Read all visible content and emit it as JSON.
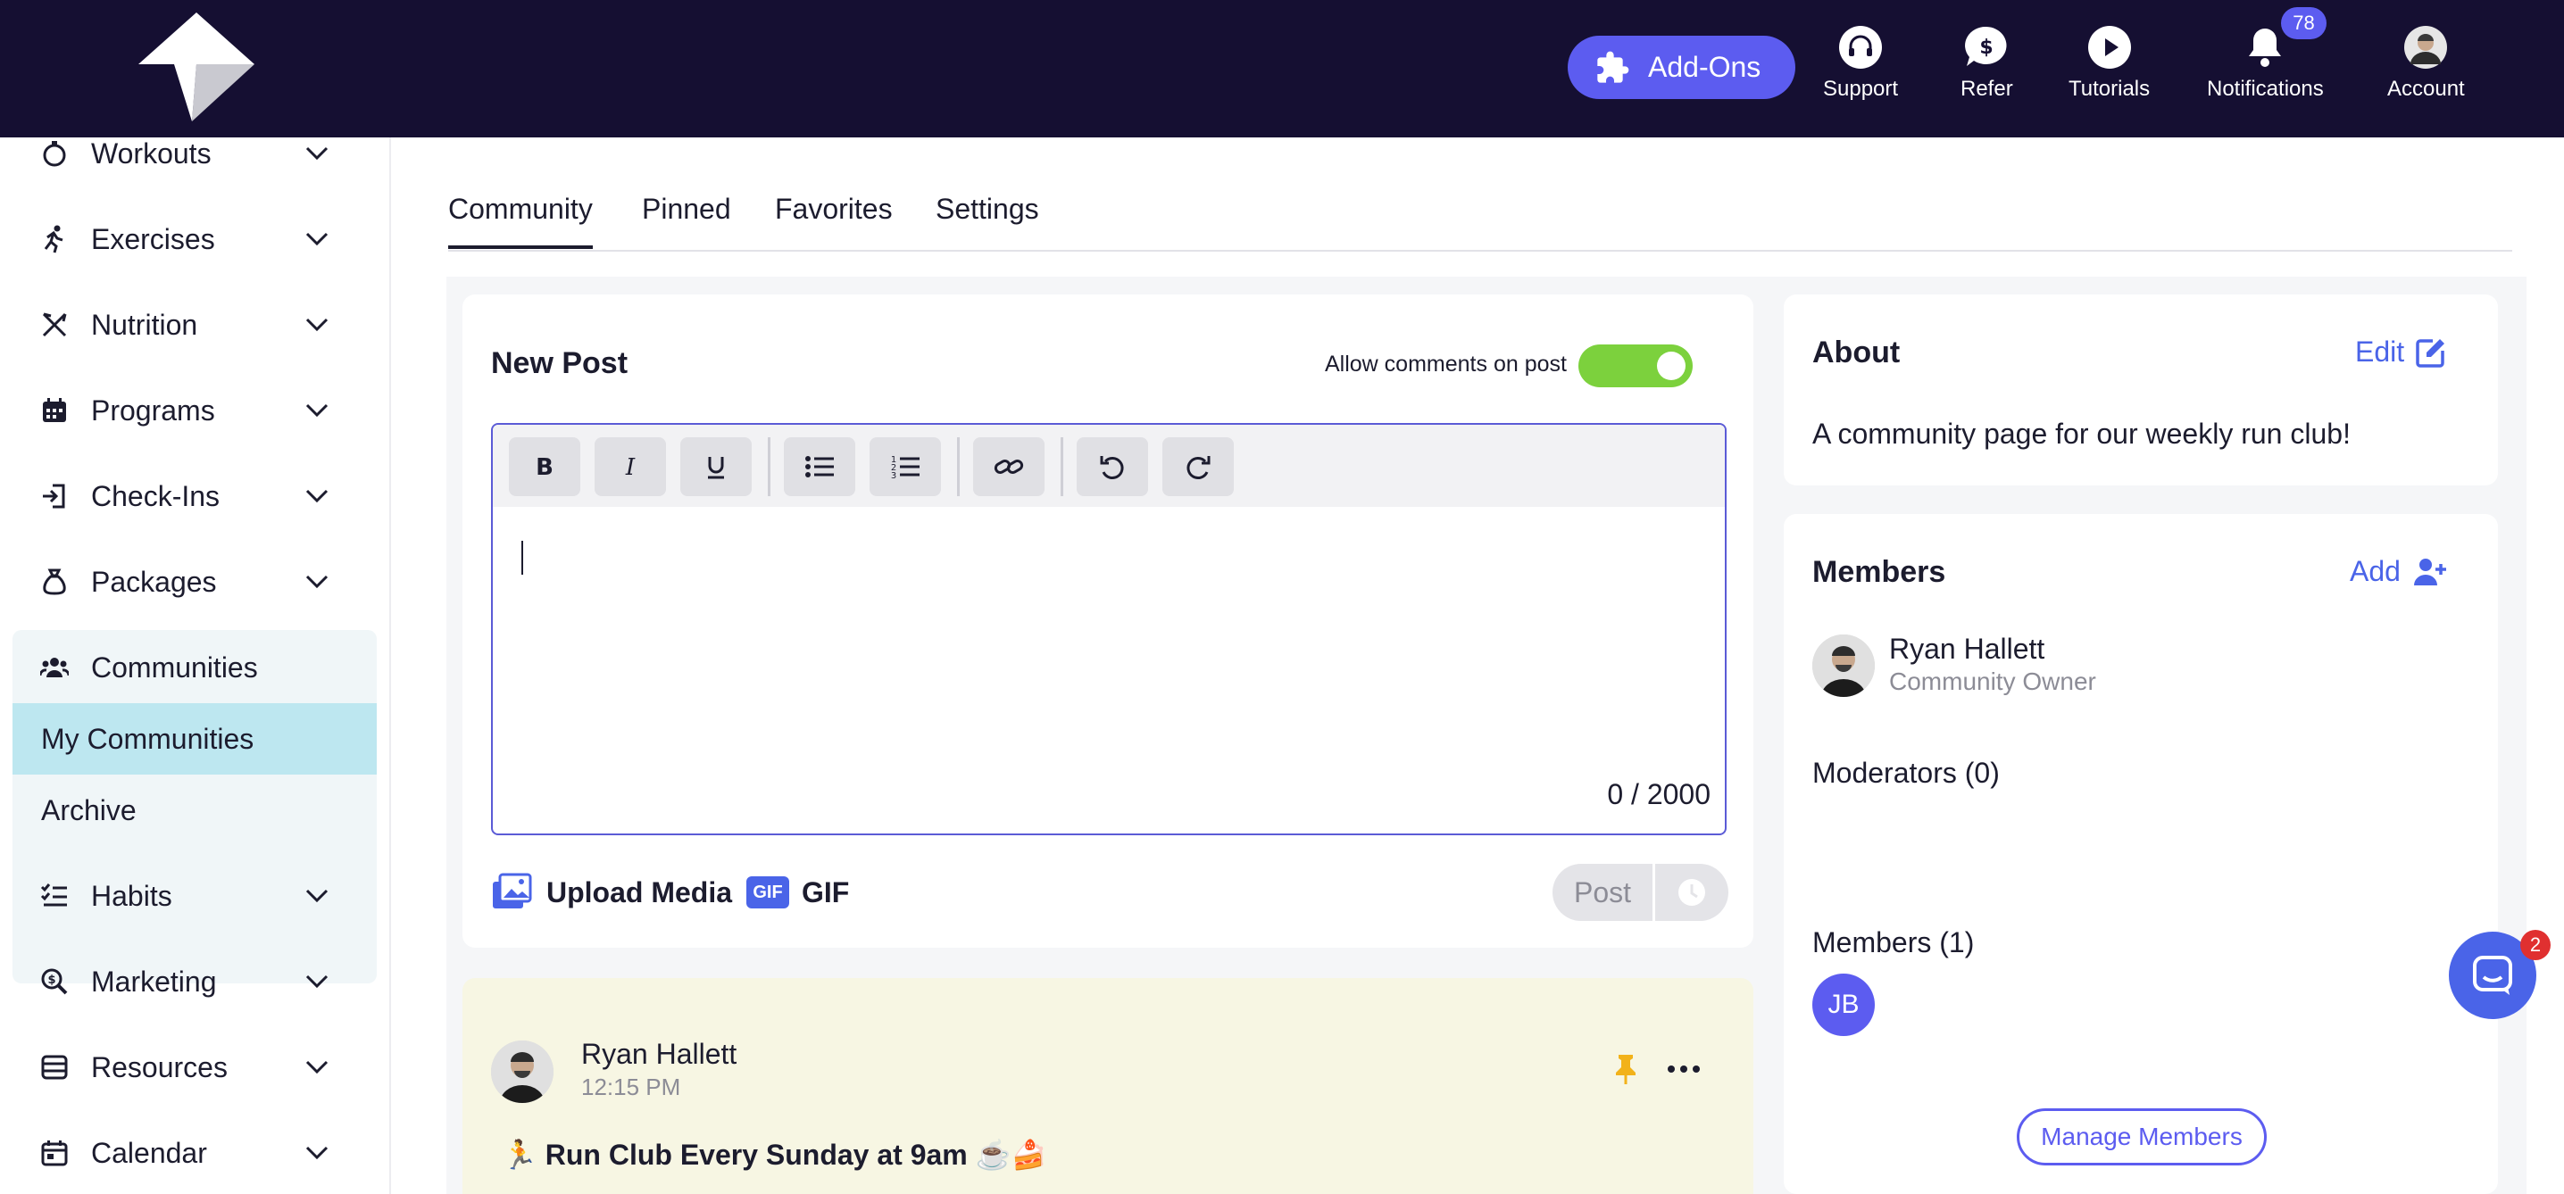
{
  "topbar": {
    "addons_label": "Add-Ons",
    "nav": [
      {
        "label": "Support",
        "icon": "headset-icon"
      },
      {
        "label": "Refer",
        "icon": "dollar-icon"
      },
      {
        "label": "Tutorials",
        "icon": "play-icon"
      },
      {
        "label": "Notifications",
        "icon": "bell-icon"
      },
      {
        "label": "Account",
        "icon": "avatar"
      }
    ],
    "notification_count": "78"
  },
  "sidebar": {
    "items": [
      {
        "label": "Workouts"
      },
      {
        "label": "Exercises"
      },
      {
        "label": "Nutrition"
      },
      {
        "label": "Programs"
      },
      {
        "label": "Check-Ins"
      },
      {
        "label": "Packages"
      },
      {
        "label": "Communities"
      },
      {
        "label": "Habits"
      },
      {
        "label": "Marketing"
      },
      {
        "label": "Resources"
      },
      {
        "label": "Calendar"
      }
    ],
    "sub_items": [
      {
        "label": "My Communities"
      },
      {
        "label": "Archive"
      }
    ]
  },
  "tabs": [
    "Community",
    "Pinned",
    "Favorites",
    "Settings"
  ],
  "composer": {
    "title": "New Post",
    "allow_comments_label": "Allow comments on post",
    "allow_comments": true,
    "char_count": "0 / 2000",
    "upload_label": "Upload Media",
    "gif_badge": "GIF",
    "gif_label": "GIF",
    "post_label": "Post"
  },
  "feed": {
    "author": "Ryan Hallett",
    "time": "12:15 PM",
    "title": "🏃 Run Club Every Sunday at 9am ☕🍰"
  },
  "about": {
    "title": "About",
    "edit_label": "Edit",
    "text": "A community page for our weekly run club!"
  },
  "members": {
    "title": "Members",
    "add_label": "Add",
    "owner_name": "Ryan Hallett",
    "owner_role": "Community Owner",
    "moderators_label": "Moderators (0)",
    "members_label": "Members (1)",
    "member_initials": "JB",
    "manage_label": "Manage Members"
  },
  "chat": {
    "badge": "2"
  },
  "colors": {
    "accent": "#5c5cf0",
    "topbar": "#150f32",
    "toggle_on": "#7cd13d",
    "link": "#4a64e8"
  }
}
